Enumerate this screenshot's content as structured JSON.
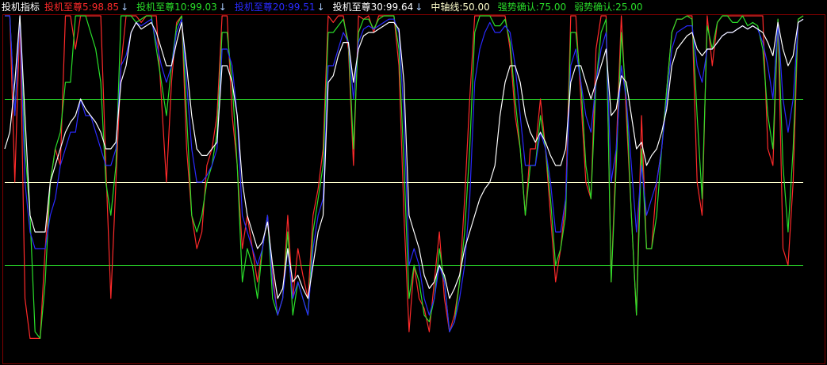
{
  "header": {
    "indicator_name": "投机指标"
  },
  "colors": {
    "background": "#000000",
    "frame": "#800000",
    "series_red": "#ff2a2a",
    "series_green": "#2adf2a",
    "series_blue": "#2a2aff",
    "series_white": "#ffffff",
    "line_mid": "#ffffcc",
    "line_strong": "#2adf2a",
    "line_weak": "#2adf2a",
    "arrow_color": "#aaccff"
  },
  "legend": {
    "items": [
      {
        "label": "投机至尊5:98.85",
        "color": "#ff2a2a",
        "arrow": "↓",
        "arrow_name": "arrow-down-icon"
      },
      {
        "label": "投机至尊10:99.03",
        "color": "#2adf2a",
        "arrow": "↓",
        "arrow_name": "arrow-down-icon"
      },
      {
        "label": "投机至尊20:99.51",
        "color": "#2a2aff",
        "arrow": "↓",
        "arrow_name": "arrow-down-icon"
      },
      {
        "label": "投机至尊30:99.64",
        "color": "#ffffff",
        "arrow": "↓",
        "arrow_name": "arrow-down-icon"
      },
      {
        "label": "中轴线:50.00",
        "color": "#ffffcc",
        "arrow": "",
        "arrow_name": ""
      },
      {
        "label": "强势确认:75.00",
        "color": "#2adf2a",
        "arrow": "",
        "arrow_name": ""
      },
      {
        "label": "弱势确认:25.00",
        "color": "#2adf2a",
        "arrow": "",
        "arrow_name": ""
      }
    ]
  },
  "chart_data": {
    "type": "line",
    "title": "",
    "xlabel": "",
    "ylabel": "",
    "ylim": [
      0,
      100
    ],
    "grid": false,
    "legend_position": "top-left",
    "horizontal_lines": [
      {
        "name": "中轴线",
        "value": 50,
        "color": "#ffffcc"
      },
      {
        "name": "强势确认",
        "value": 75,
        "color": "#2adf2a"
      },
      {
        "name": "弱势确认",
        "value": 25,
        "color": "#2adf2a"
      }
    ],
    "series": [
      {
        "name": "投机至尊5",
        "color": "#ff2a2a",
        "values": [
          100,
          100,
          50,
          100,
          15,
          3,
          3,
          3,
          30,
          50,
          60,
          55,
          100,
          100,
          90,
          100,
          100,
          100,
          100,
          100,
          55,
          15,
          50,
          85,
          100,
          100,
          100,
          98,
          100,
          100,
          100,
          75,
          50,
          80,
          98,
          100,
          60,
          40,
          30,
          35,
          55,
          60,
          70,
          100,
          100,
          70,
          55,
          30,
          40,
          30,
          20,
          30,
          40,
          22,
          10,
          15,
          40,
          15,
          30,
          22,
          15,
          40,
          48,
          60,
          100,
          98,
          100,
          100,
          90,
          55,
          100,
          99,
          100,
          95,
          100,
          100,
          100,
          100,
          85,
          40,
          5,
          25,
          15,
          12,
          5,
          20,
          35,
          15,
          5,
          10,
          20,
          45,
          75,
          100,
          100,
          100,
          100,
          100,
          100,
          100,
          90,
          70,
          60,
          40,
          60,
          60,
          75,
          60,
          40,
          20,
          30,
          45,
          100,
          100,
          75,
          50,
          45,
          90,
          100,
          100,
          20,
          60,
          100,
          70,
          40,
          10,
          70,
          30,
          30,
          50,
          60,
          78,
          95,
          99,
          99,
          100,
          100,
          50,
          40,
          100,
          85,
          98,
          100,
          100,
          100,
          100,
          100,
          100,
          100,
          100,
          100,
          60,
          55,
          99,
          30,
          25,
          50,
          99,
          100
        ]
      },
      {
        "name": "投机至尊10",
        "color": "#2adf2a",
        "values": [
          100,
          100,
          70,
          100,
          60,
          40,
          5,
          3,
          20,
          50,
          60,
          65,
          80,
          80,
          100,
          100,
          100,
          95,
          90,
          80,
          50,
          40,
          55,
          100,
          100,
          100,
          98,
          99,
          100,
          100,
          90,
          80,
          70,
          85,
          97,
          100,
          70,
          40,
          35,
          40,
          50,
          55,
          65,
          95,
          95,
          80,
          55,
          20,
          30,
          25,
          15,
          30,
          40,
          15,
          10,
          15,
          35,
          10,
          20,
          15,
          10,
          35,
          45,
          55,
          95,
          95,
          97,
          99,
          92,
          60,
          95,
          99,
          99,
          96,
          99,
          100,
          100,
          100,
          90,
          55,
          15,
          25,
          20,
          10,
          8,
          15,
          30,
          20,
          5,
          8,
          20,
          35,
          60,
          95,
          100,
          100,
          100,
          97,
          97,
          99,
          92,
          75,
          60,
          40,
          55,
          55,
          70,
          60,
          45,
          25,
          30,
          40,
          95,
          95,
          80,
          55,
          45,
          80,
          95,
          99,
          20,
          55,
          95,
          75,
          40,
          10,
          60,
          30,
          30,
          40,
          60,
          78,
          95,
          99,
          99,
          100,
          99,
          70,
          45,
          97,
          90,
          98,
          100,
          100,
          98,
          98,
          100,
          97,
          98,
          97,
          90,
          70,
          60,
          99,
          55,
          35,
          60,
          99,
          100
        ]
      },
      {
        "name": "投机至尊20",
        "color": "#2a2aff",
        "values": [
          100,
          100,
          70,
          100,
          50,
          35,
          30,
          30,
          30,
          40,
          45,
          55,
          60,
          65,
          65,
          75,
          70,
          70,
          65,
          60,
          55,
          55,
          60,
          85,
          88,
          95,
          98,
          97,
          98,
          99,
          92,
          85,
          80,
          85,
          95,
          99,
          80,
          60,
          50,
          50,
          52,
          55,
          60,
          90,
          90,
          85,
          70,
          40,
          35,
          30,
          25,
          30,
          40,
          20,
          10,
          15,
          30,
          15,
          20,
          15,
          10,
          30,
          40,
          45,
          85,
          85,
          90,
          95,
          92,
          75,
          92,
          96,
          97,
          96,
          97,
          98,
          99,
          99,
          95,
          70,
          25,
          30,
          25,
          15,
          10,
          15,
          25,
          20,
          5,
          8,
          15,
          25,
          45,
          80,
          90,
          95,
          98,
          95,
          95,
          97,
          95,
          85,
          70,
          55,
          55,
          55,
          65,
          60,
          50,
          35,
          35,
          45,
          85,
          90,
          80,
          70,
          65,
          80,
          90,
          95,
          50,
          60,
          85,
          75,
          55,
          35,
          55,
          40,
          45,
          50,
          60,
          75,
          90,
          95,
          96,
          97,
          97,
          85,
          80,
          90,
          90,
          92,
          94,
          95,
          95,
          96,
          97,
          96,
          97,
          96,
          92,
          85,
          75,
          98,
          75,
          65,
          75,
          98,
          99
        ]
      },
      {
        "name": "投机至尊30",
        "color": "#ffffff",
        "values": [
          60,
          65,
          80,
          100,
          70,
          40,
          35,
          35,
          35,
          50,
          55,
          60,
          65,
          68,
          70,
          75,
          72,
          70,
          68,
          65,
          60,
          60,
          62,
          80,
          85,
          95,
          98,
          96,
          97,
          98,
          95,
          90,
          85,
          85,
          92,
          98,
          85,
          70,
          60,
          58,
          58,
          60,
          62,
          85,
          85,
          80,
          70,
          50,
          40,
          35,
          30,
          32,
          38,
          25,
          15,
          18,
          30,
          20,
          22,
          18,
          15,
          25,
          35,
          40,
          80,
          82,
          88,
          92,
          92,
          80,
          90,
          94,
          95,
          95,
          96,
          97,
          98,
          98,
          96,
          80,
          40,
          35,
          30,
          22,
          18,
          20,
          25,
          22,
          15,
          18,
          22,
          30,
          35,
          40,
          45,
          48,
          50,
          55,
          70,
          80,
          85,
          85,
          80,
          70,
          65,
          62,
          65,
          62,
          58,
          55,
          55,
          60,
          80,
          85,
          85,
          80,
          75,
          80,
          85,
          90,
          70,
          72,
          82,
          80,
          70,
          60,
          62,
          55,
          58,
          60,
          65,
          72,
          85,
          90,
          92,
          94,
          95,
          90,
          88,
          90,
          90,
          92,
          94,
          95,
          95,
          96,
          97,
          96,
          97,
          96,
          95,
          92,
          88,
          98,
          90,
          85,
          88,
          98,
          99
        ]
      }
    ]
  }
}
